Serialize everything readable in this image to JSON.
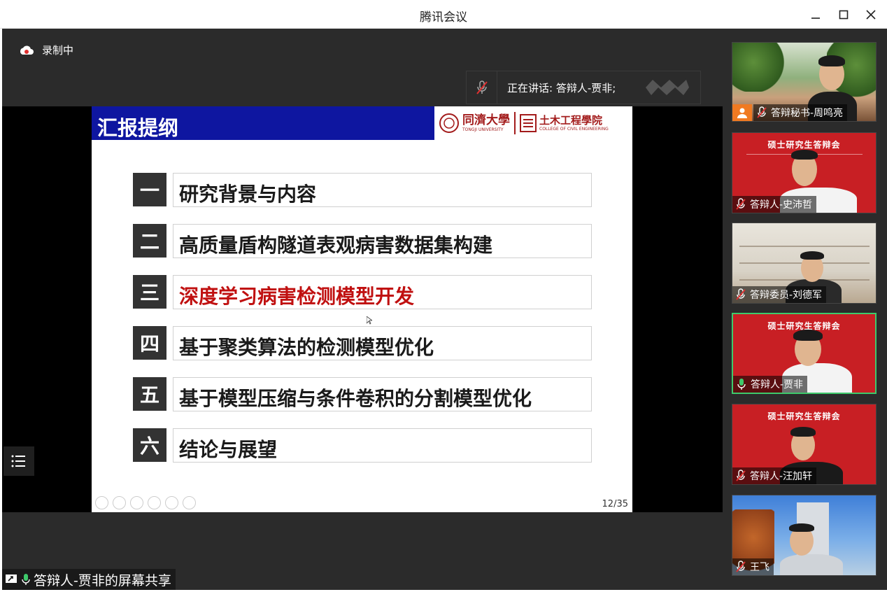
{
  "window": {
    "title": "腾讯会议"
  },
  "recording": {
    "label": "录制中"
  },
  "speaker": {
    "label": "正在讲话: 答辩人-贾非;"
  },
  "slide": {
    "header": "汇报提纲",
    "uni_name": "同濟大學",
    "uni_en": "TONGJI UNIVERSITY",
    "college_name": "土木工程學院",
    "college_en": "COLLEGE OF CIVIL ENGINEERING",
    "items": [
      {
        "num": "一",
        "text": "研究背景与内容",
        "highlight": false
      },
      {
        "num": "二",
        "text": "高质量盾构隧道表观病害数据集构建",
        "highlight": false
      },
      {
        "num": "三",
        "text": "深度学习病害检测模型开发",
        "highlight": true
      },
      {
        "num": "四",
        "text": "基于聚类算法的检测模型优化",
        "highlight": false
      },
      {
        "num": "五",
        "text": "基于模型压缩与条件卷积的分割模型优化",
        "highlight": false
      },
      {
        "num": "六",
        "text": "结论与展望",
        "highlight": false
      }
    ],
    "page": "12/35"
  },
  "share": {
    "label": "答辩人-贾非的屏幕共享"
  },
  "participants": [
    {
      "name": "答辩秘书-周鸣亮",
      "banner": ""
    },
    {
      "name": "答辩人-史沛哲",
      "banner": "硕士研究生答辩会"
    },
    {
      "name": "答辩委员-刘德军",
      "banner": ""
    },
    {
      "name": "答辩人-贾非",
      "banner": "硕士研究生答辩会"
    },
    {
      "name": "答辩人-汪加轩",
      "banner": "硕士研究生答辩会"
    },
    {
      "name": "王飞",
      "banner": ""
    }
  ],
  "colors": {
    "slide_header": "#0e16a0",
    "highlight": "#c01010",
    "active_border": "#3ec96b",
    "banner_red": "#c81f24"
  }
}
